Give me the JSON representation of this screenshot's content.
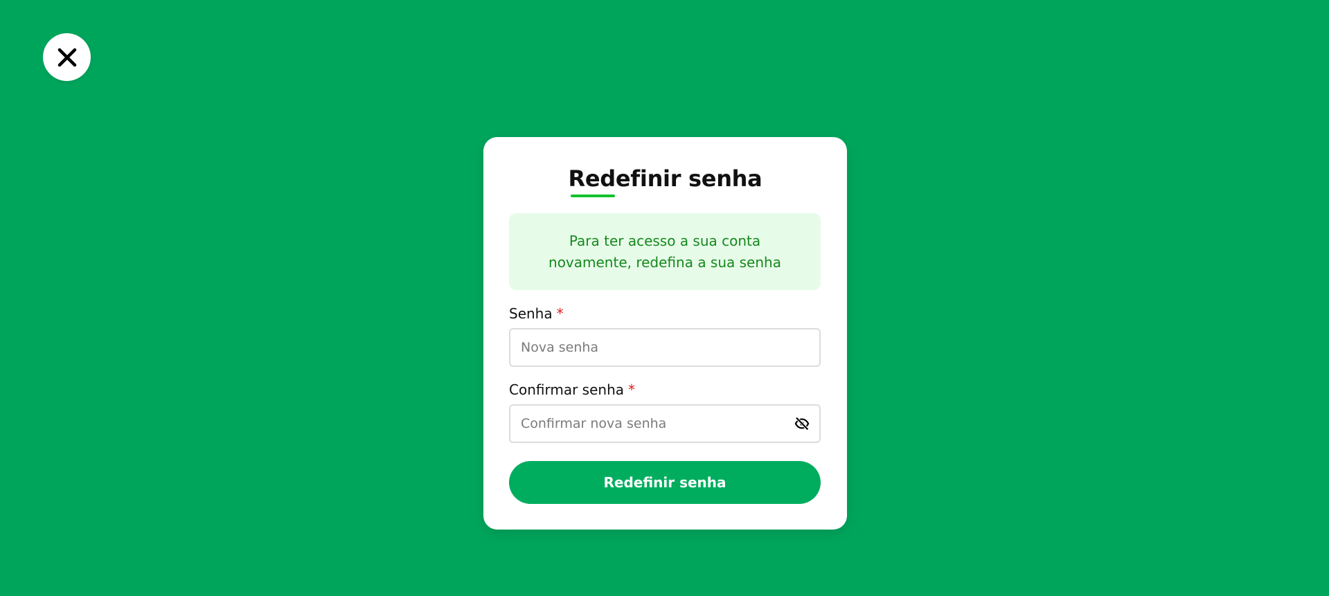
{
  "colors": {
    "page_background": "#00a55c",
    "card_background": "#ffffff",
    "accent_green": "#00ad5f",
    "title_underline": "#13c22b",
    "info_background": "#e7fbe9",
    "info_text": "#15891c",
    "required_star": "#e21b1b"
  },
  "close_button": {
    "icon": "close-icon"
  },
  "card": {
    "title": "Redefinir senha",
    "info_message": "Para ter acesso a sua conta\nnovamente, redefina a sua senha"
  },
  "form": {
    "password": {
      "label": "Senha",
      "required_mark": "*",
      "placeholder": "Nova senha",
      "value": ""
    },
    "confirm_password": {
      "label": "Confirmar senha",
      "required_mark": "*",
      "placeholder": "Confirmar nova senha",
      "value": "",
      "toggle_icon": "eye-off-icon"
    },
    "submit_label": "Redefinir senha"
  }
}
